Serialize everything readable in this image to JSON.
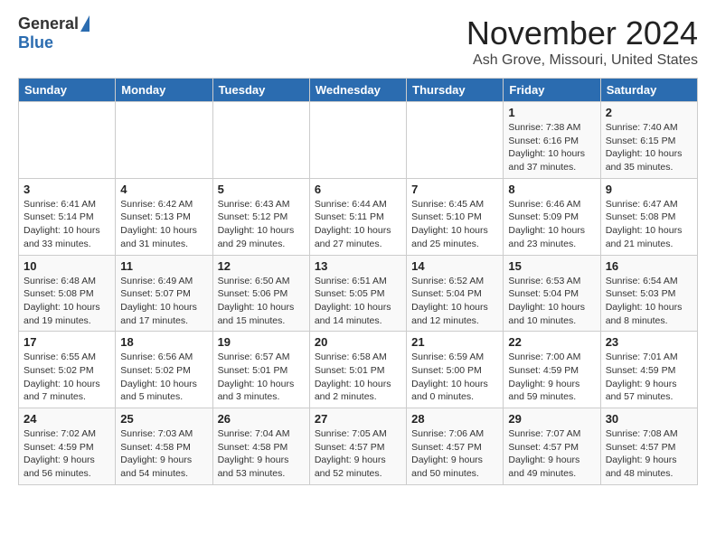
{
  "header": {
    "logo_general": "General",
    "logo_blue": "Blue",
    "month": "November 2024",
    "location": "Ash Grove, Missouri, United States"
  },
  "days_of_week": [
    "Sunday",
    "Monday",
    "Tuesday",
    "Wednesday",
    "Thursday",
    "Friday",
    "Saturday"
  ],
  "weeks": [
    [
      {
        "day": "",
        "info": ""
      },
      {
        "day": "",
        "info": ""
      },
      {
        "day": "",
        "info": ""
      },
      {
        "day": "",
        "info": ""
      },
      {
        "day": "",
        "info": ""
      },
      {
        "day": "1",
        "info": "Sunrise: 7:38 AM\nSunset: 6:16 PM\nDaylight: 10 hours\nand 37 minutes."
      },
      {
        "day": "2",
        "info": "Sunrise: 7:40 AM\nSunset: 6:15 PM\nDaylight: 10 hours\nand 35 minutes."
      }
    ],
    [
      {
        "day": "3",
        "info": "Sunrise: 6:41 AM\nSunset: 5:14 PM\nDaylight: 10 hours\nand 33 minutes."
      },
      {
        "day": "4",
        "info": "Sunrise: 6:42 AM\nSunset: 5:13 PM\nDaylight: 10 hours\nand 31 minutes."
      },
      {
        "day": "5",
        "info": "Sunrise: 6:43 AM\nSunset: 5:12 PM\nDaylight: 10 hours\nand 29 minutes."
      },
      {
        "day": "6",
        "info": "Sunrise: 6:44 AM\nSunset: 5:11 PM\nDaylight: 10 hours\nand 27 minutes."
      },
      {
        "day": "7",
        "info": "Sunrise: 6:45 AM\nSunset: 5:10 PM\nDaylight: 10 hours\nand 25 minutes."
      },
      {
        "day": "8",
        "info": "Sunrise: 6:46 AM\nSunset: 5:09 PM\nDaylight: 10 hours\nand 23 minutes."
      },
      {
        "day": "9",
        "info": "Sunrise: 6:47 AM\nSunset: 5:08 PM\nDaylight: 10 hours\nand 21 minutes."
      }
    ],
    [
      {
        "day": "10",
        "info": "Sunrise: 6:48 AM\nSunset: 5:08 PM\nDaylight: 10 hours\nand 19 minutes."
      },
      {
        "day": "11",
        "info": "Sunrise: 6:49 AM\nSunset: 5:07 PM\nDaylight: 10 hours\nand 17 minutes."
      },
      {
        "day": "12",
        "info": "Sunrise: 6:50 AM\nSunset: 5:06 PM\nDaylight: 10 hours\nand 15 minutes."
      },
      {
        "day": "13",
        "info": "Sunrise: 6:51 AM\nSunset: 5:05 PM\nDaylight: 10 hours\nand 14 minutes."
      },
      {
        "day": "14",
        "info": "Sunrise: 6:52 AM\nSunset: 5:04 PM\nDaylight: 10 hours\nand 12 minutes."
      },
      {
        "day": "15",
        "info": "Sunrise: 6:53 AM\nSunset: 5:04 PM\nDaylight: 10 hours\nand 10 minutes."
      },
      {
        "day": "16",
        "info": "Sunrise: 6:54 AM\nSunset: 5:03 PM\nDaylight: 10 hours\nand 8 minutes."
      }
    ],
    [
      {
        "day": "17",
        "info": "Sunrise: 6:55 AM\nSunset: 5:02 PM\nDaylight: 10 hours\nand 7 minutes."
      },
      {
        "day": "18",
        "info": "Sunrise: 6:56 AM\nSunset: 5:02 PM\nDaylight: 10 hours\nand 5 minutes."
      },
      {
        "day": "19",
        "info": "Sunrise: 6:57 AM\nSunset: 5:01 PM\nDaylight: 10 hours\nand 3 minutes."
      },
      {
        "day": "20",
        "info": "Sunrise: 6:58 AM\nSunset: 5:01 PM\nDaylight: 10 hours\nand 2 minutes."
      },
      {
        "day": "21",
        "info": "Sunrise: 6:59 AM\nSunset: 5:00 PM\nDaylight: 10 hours\nand 0 minutes."
      },
      {
        "day": "22",
        "info": "Sunrise: 7:00 AM\nSunset: 4:59 PM\nDaylight: 9 hours\nand 59 minutes."
      },
      {
        "day": "23",
        "info": "Sunrise: 7:01 AM\nSunset: 4:59 PM\nDaylight: 9 hours\nand 57 minutes."
      }
    ],
    [
      {
        "day": "24",
        "info": "Sunrise: 7:02 AM\nSunset: 4:59 PM\nDaylight: 9 hours\nand 56 minutes."
      },
      {
        "day": "25",
        "info": "Sunrise: 7:03 AM\nSunset: 4:58 PM\nDaylight: 9 hours\nand 54 minutes."
      },
      {
        "day": "26",
        "info": "Sunrise: 7:04 AM\nSunset: 4:58 PM\nDaylight: 9 hours\nand 53 minutes."
      },
      {
        "day": "27",
        "info": "Sunrise: 7:05 AM\nSunset: 4:57 PM\nDaylight: 9 hours\nand 52 minutes."
      },
      {
        "day": "28",
        "info": "Sunrise: 7:06 AM\nSunset: 4:57 PM\nDaylight: 9 hours\nand 50 minutes."
      },
      {
        "day": "29",
        "info": "Sunrise: 7:07 AM\nSunset: 4:57 PM\nDaylight: 9 hours\nand 49 minutes."
      },
      {
        "day": "30",
        "info": "Sunrise: 7:08 AM\nSunset: 4:57 PM\nDaylight: 9 hours\nand 48 minutes."
      }
    ]
  ]
}
